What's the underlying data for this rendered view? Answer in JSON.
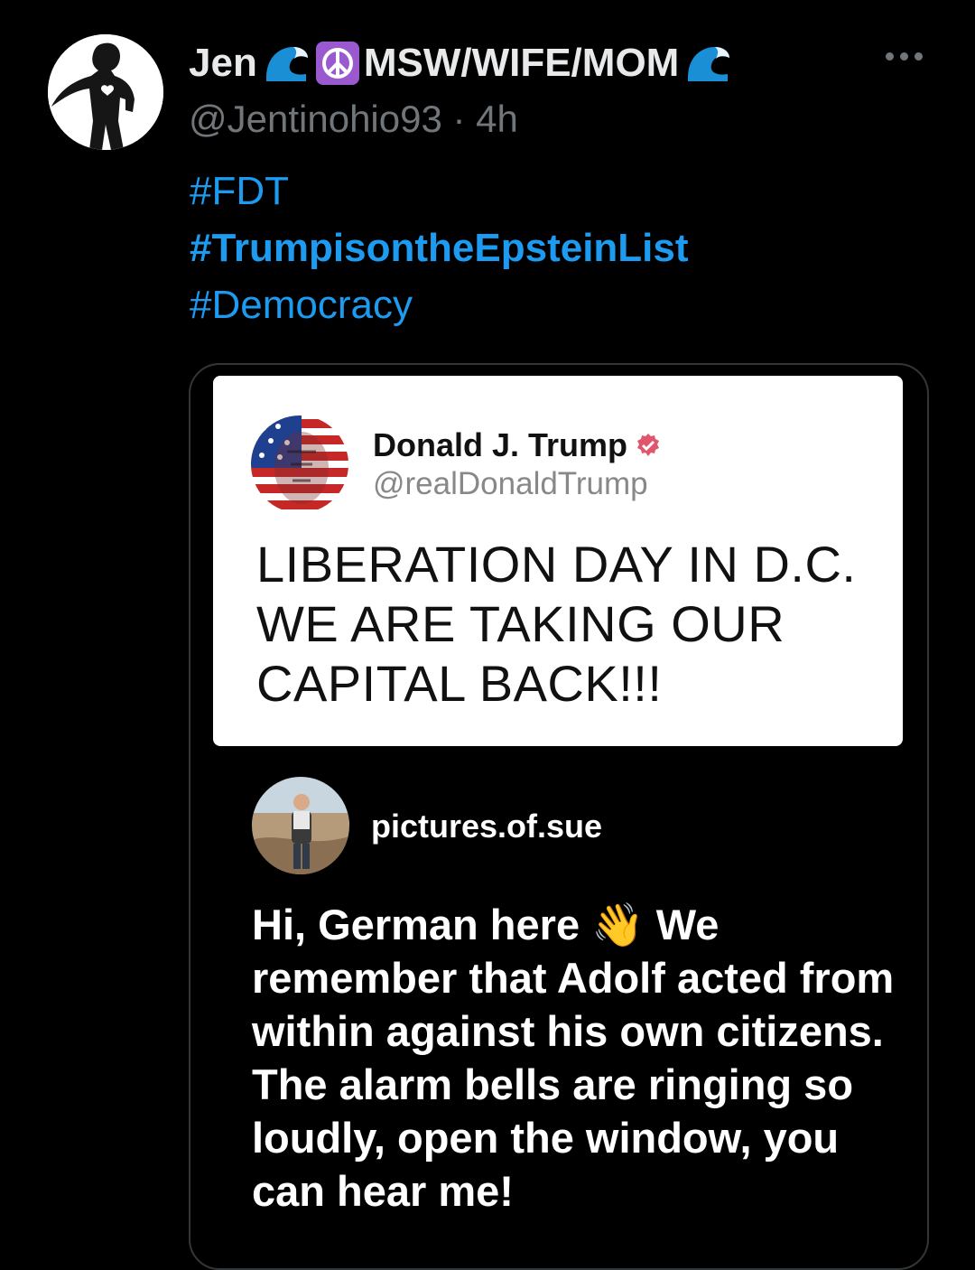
{
  "tweet": {
    "display_name_prefix": "Jen",
    "display_name_middle": "MSW/WIFE/MOM",
    "handle": "@Jentinohio93",
    "separator": " · ",
    "time": "4h",
    "hashtags": [
      "#FDT",
      "#TrumpisontheEpsteinList",
      "#Democracy"
    ]
  },
  "embedded": {
    "trump_post": {
      "name": "Donald J. Trump",
      "handle": "@realDonaldTrump",
      "text": "LIBERATION DAY IN D.C. WE ARE TAKING OUR CAPITAL BACK!!!"
    },
    "reply": {
      "username": "pictures.of.sue",
      "text_before_emoji": "Hi, German here ",
      "emoji": "👋",
      "text_after_emoji": " We remember that Adolf acted from within against his own citizens. The alarm bells are ringing so loudly, open the window, you can hear me!"
    }
  },
  "icons": {
    "wave": "wave-emoji-icon",
    "peace": "peace-sign-icon",
    "verified": "verified-badge-icon",
    "more": "more-options-icon"
  },
  "colors": {
    "background": "#000000",
    "link": "#1d9bf0",
    "muted": "#71767b",
    "wave": "#1a8fd6",
    "peace_bg": "#9b59d0",
    "verified": "#e0566c"
  }
}
